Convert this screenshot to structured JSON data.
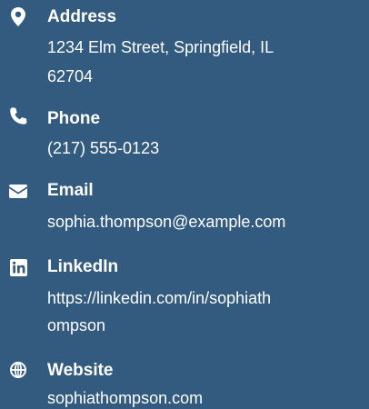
{
  "contact": {
    "address": {
      "icon": "map-pin-icon",
      "label": "Address",
      "value_line1": "1234 Elm Street, Springfield, IL",
      "value_line2": "62704"
    },
    "phone": {
      "icon": "phone-icon",
      "label": "Phone",
      "value": "(217) 555-0123"
    },
    "email": {
      "icon": "envelope-icon",
      "label": "Email",
      "value": "sophia.thompson@example.com"
    },
    "linkedin": {
      "icon": "linkedin-icon",
      "label": "LinkedIn",
      "value_line1": "https://linkedin.com/in/sophiath",
      "value_line2": "ompson"
    },
    "website": {
      "icon": "globe-icon",
      "label": "Website",
      "value": "sophiathompson.com"
    }
  },
  "colors": {
    "background": "#335b80",
    "text": "#ffffff"
  }
}
